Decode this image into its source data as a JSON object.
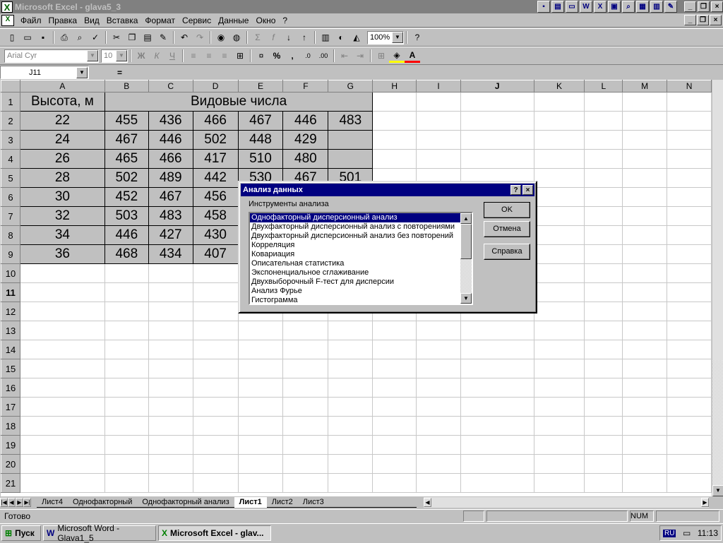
{
  "window": {
    "title": "Microsoft Excel - glava5_3"
  },
  "menu": [
    "Файл",
    "Правка",
    "Вид",
    "Вставка",
    "Формат",
    "Сервис",
    "Данные",
    "Окно",
    "?"
  ],
  "toolbar": {
    "zoom": "100%",
    "font": "Arial Cyr",
    "font_size": "10"
  },
  "formula_bar": {
    "name_box": "J11",
    "equals": "="
  },
  "sheet": {
    "columns": [
      "A",
      "B",
      "C",
      "D",
      "E",
      "F",
      "G",
      "H",
      "I",
      "J",
      "K",
      "L",
      "M",
      "N"
    ],
    "row_numbers": [
      "1",
      "2",
      "3",
      "4",
      "5",
      "6",
      "7",
      "8",
      "9",
      "10",
      "11",
      "12",
      "13",
      "14",
      "15",
      "16",
      "17",
      "18",
      "19",
      "20",
      "21"
    ],
    "header_height": "Высота, м",
    "header_species": "Видовые числа",
    "rows": [
      [
        "22",
        "455",
        "436",
        "466",
        "467",
        "446",
        "483"
      ],
      [
        "24",
        "467",
        "446",
        "502",
        "448",
        "429",
        ""
      ],
      [
        "26",
        "465",
        "466",
        "417",
        "510",
        "480",
        ""
      ],
      [
        "28",
        "502",
        "489",
        "442",
        "530",
        "467",
        "501"
      ],
      [
        "30",
        "452",
        "467",
        "456",
        "",
        "",
        ""
      ],
      [
        "32",
        "503",
        "483",
        "458",
        "",
        "",
        ""
      ],
      [
        "34",
        "446",
        "427",
        "430",
        "",
        "",
        ""
      ],
      [
        "36",
        "468",
        "434",
        "407",
        "",
        "",
        ""
      ]
    ]
  },
  "sheet_tabs": [
    "Лист4",
    "Однофакторный",
    "Однофакторный анализ",
    "Лист1",
    "Лист2",
    "Лист3"
  ],
  "active_tab": "Лист1",
  "status": {
    "text": "Готово",
    "num": "NUM"
  },
  "taskbar": {
    "start": "Пуск",
    "tasks": [
      "Microsoft Word - Glava1_5",
      "Microsoft Excel - glav..."
    ],
    "lang": "RU",
    "clock": "11:13"
  },
  "dialog": {
    "title": "Анализ данных",
    "help_glyph": "?",
    "close_glyph": "×",
    "list_label": "Инструменты анализа",
    "items": [
      "Однофакторный дисперсионный анализ",
      "Двухфакторный дисперсионный анализ с повторениями",
      "Двухфакторный дисперсионный анализ без повторений",
      "Корреляция",
      "Ковариация",
      "Описательная статистика",
      "Экспоненциальное сглаживание",
      "Двухвыборочный F-тест для дисперсии",
      "Анализ Фурье",
      "Гистограмма"
    ],
    "ok": "OK",
    "cancel": "Отмена",
    "help": "Справка"
  }
}
